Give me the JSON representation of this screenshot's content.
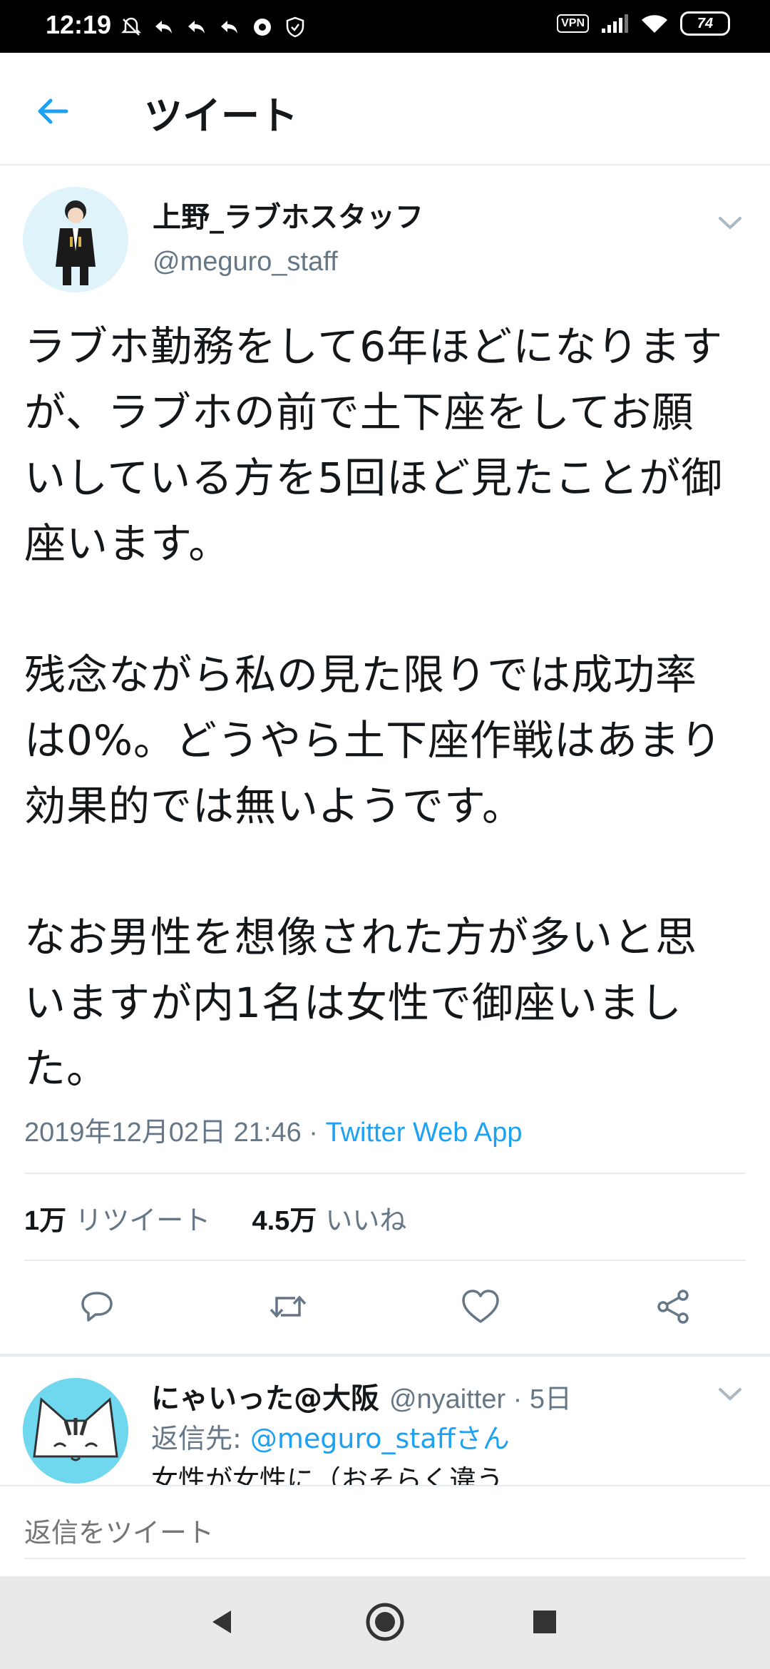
{
  "status_bar": {
    "time": "12:19",
    "vpn": "VPN",
    "battery": "74",
    "left_icons": [
      "mute-bell-icon",
      "reply-icon",
      "reply-icon",
      "reply-icon",
      "sync-icon",
      "shield-icon"
    ],
    "right_icons": [
      "signal-icon",
      "wifi-icon",
      "battery-icon"
    ]
  },
  "app_bar": {
    "title": "ツイート",
    "back_icon": "arrow-left-icon"
  },
  "tweet": {
    "author_name": "上野_ラブホスタッフ",
    "author_handle": "@meguro_staff",
    "text": "ラブホ勤務をして6年ほどになります\nが、ラブホの前で土下座をしてお願\nいしている方を5回ほど見たことが御\n座います。\n\n残念ながら私の見た限りでは成功率\nは0%。どうやら土下座作戦はあまり\n効果的では無いようです。\n\nなお男性を想像された方が多いと思\nいますが内1名は女性で御座いまし\nた。",
    "timestamp": "2019年12月02日 21:46 · ",
    "source": "Twitter Web App",
    "retweet_count": "1万",
    "retweet_label": "リツイート",
    "like_count": "4.5万",
    "like_label": "いいね"
  },
  "actions": [
    "reply-icon",
    "retweet-icon",
    "like-icon",
    "share-icon"
  ],
  "reply": {
    "name": "にゃいった@大阪",
    "handle": "@nyaitter · 5日",
    "reply_to_label": "返信先: ",
    "reply_to_mention": "@meguro_staffさん",
    "snippet": "女性が女性に（おそらく違う"
  },
  "compose": {
    "placeholder": "返信をツイート"
  },
  "colors": {
    "accent": "#1da1f2",
    "secondary_text": "#657786",
    "divider": "#e6ecf0"
  }
}
